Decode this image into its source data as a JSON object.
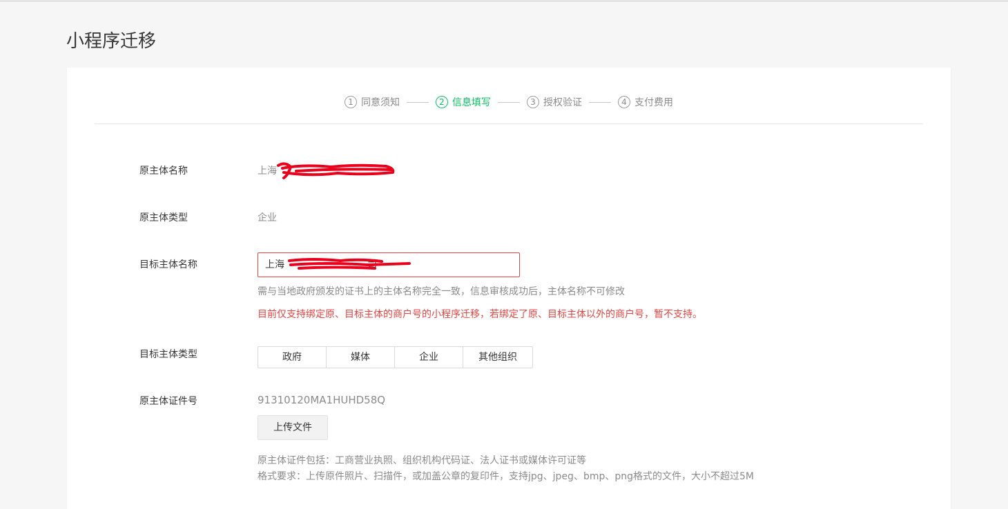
{
  "page": {
    "title": "小程序迁移"
  },
  "steps": [
    {
      "num": "1",
      "label": "同意须知",
      "active": false
    },
    {
      "num": "2",
      "label": "信息填写",
      "active": true
    },
    {
      "num": "3",
      "label": "授权验证",
      "active": false
    },
    {
      "num": "4",
      "label": "支付费用",
      "active": false
    }
  ],
  "form": {
    "original_name": {
      "label": "原主体名称",
      "value": "上海"
    },
    "original_type": {
      "label": "原主体类型",
      "value": "企业"
    },
    "target_name": {
      "label": "目标主体名称",
      "value": "上海",
      "value_tail": "司",
      "hint": "需与当地政府颁发的证书上的主体名称完全一致，信息审核成功后，主体名称不可修改",
      "warning": "目前仅支持绑定原、目标主体的商户号的小程序迁移，若绑定了原、目标主体以外的商户号，暂不支持。"
    },
    "target_type": {
      "label": "目标主体类型",
      "options": [
        "政府",
        "媒体",
        "企业",
        "其他组织"
      ]
    },
    "original_cert": {
      "label": "原主体证件号",
      "value": "91310120MA1HUHD58Q",
      "upload_label": "上传文件",
      "hint_1": "原主体证件包括：工商营业执照、组织机构代码证、法人证书或媒体许可证等",
      "hint_2": "格式要求：上传原件照片、扫描件，或加盖公章的复印件，支持jpg、jpeg、bmp、png格式的文件，大小不超过5M"
    }
  },
  "colors": {
    "accent": "#07c160",
    "error": "#e64340",
    "redaction": "#e8001c"
  }
}
